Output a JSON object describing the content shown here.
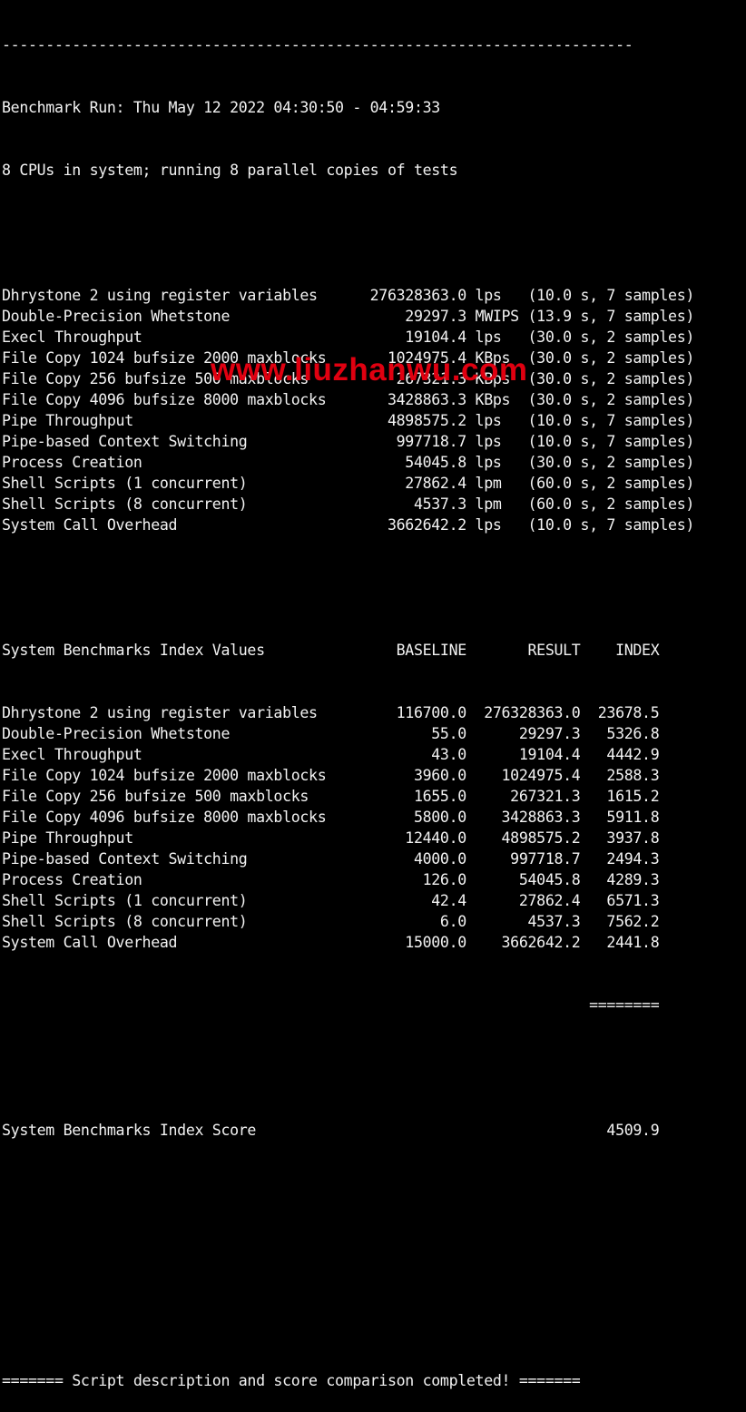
{
  "separator_top": "------------------------------------------------------------------------",
  "header": {
    "run_line": "Benchmark Run: Thu May 12 2022 04:30:50 - 04:59:33",
    "cpu_line": "8 CPUs in system; running 8 parallel copies of tests"
  },
  "results": [
    {
      "name": "Dhrystone 2 using register variables",
      "value": "276328363.0",
      "unit": "lps",
      "time": "10.0 s",
      "samples": "7 samples"
    },
    {
      "name": "Double-Precision Whetstone",
      "value": "29297.3",
      "unit": "MWIPS",
      "time": "13.9 s",
      "samples": "7 samples"
    },
    {
      "name": "Execl Throughput",
      "value": "19104.4",
      "unit": "lps",
      "time": "30.0 s",
      "samples": "2 samples"
    },
    {
      "name": "File Copy 1024 bufsize 2000 maxblocks",
      "value": "1024975.4",
      "unit": "KBps",
      "time": "30.0 s",
      "samples": "2 samples"
    },
    {
      "name": "File Copy 256 bufsize 500 maxblocks",
      "value": "267321.3",
      "unit": "KBps",
      "time": "30.0 s",
      "samples": "2 samples"
    },
    {
      "name": "File Copy 4096 bufsize 8000 maxblocks",
      "value": "3428863.3",
      "unit": "KBps",
      "time": "30.0 s",
      "samples": "2 samples"
    },
    {
      "name": "Pipe Throughput",
      "value": "4898575.2",
      "unit": "lps",
      "time": "10.0 s",
      "samples": "7 samples"
    },
    {
      "name": "Pipe-based Context Switching",
      "value": "997718.7",
      "unit": "lps",
      "time": "10.0 s",
      "samples": "7 samples"
    },
    {
      "name": "Process Creation",
      "value": "54045.8",
      "unit": "lps",
      "time": "30.0 s",
      "samples": "2 samples"
    },
    {
      "name": "Shell Scripts (1 concurrent)",
      "value": "27862.4",
      "unit": "lpm",
      "time": "60.0 s",
      "samples": "2 samples"
    },
    {
      "name": "Shell Scripts (8 concurrent)",
      "value": "4537.3",
      "unit": "lpm",
      "time": "60.0 s",
      "samples": "2 samples"
    },
    {
      "name": "System Call Overhead",
      "value": "3662642.2",
      "unit": "lps",
      "time": "10.0 s",
      "samples": "7 samples"
    }
  ],
  "index_table": {
    "title": "System Benchmarks Index Values",
    "columns": [
      "BASELINE",
      "RESULT",
      "INDEX"
    ],
    "rows": [
      {
        "name": "Dhrystone 2 using register variables",
        "baseline": "116700.0",
        "result": "276328363.0",
        "index": "23678.5"
      },
      {
        "name": "Double-Precision Whetstone",
        "baseline": "55.0",
        "result": "29297.3",
        "index": "5326.8"
      },
      {
        "name": "Execl Throughput",
        "baseline": "43.0",
        "result": "19104.4",
        "index": "4442.9"
      },
      {
        "name": "File Copy 1024 bufsize 2000 maxblocks",
        "baseline": "3960.0",
        "result": "1024975.4",
        "index": "2588.3"
      },
      {
        "name": "File Copy 256 bufsize 500 maxblocks",
        "baseline": "1655.0",
        "result": "267321.3",
        "index": "1615.2"
      },
      {
        "name": "File Copy 4096 bufsize 8000 maxblocks",
        "baseline": "5800.0",
        "result": "3428863.3",
        "index": "5911.8"
      },
      {
        "name": "Pipe Throughput",
        "baseline": "12440.0",
        "result": "4898575.2",
        "index": "3937.8"
      },
      {
        "name": "Pipe-based Context Switching",
        "baseline": "4000.0",
        "result": "997718.7",
        "index": "2494.3"
      },
      {
        "name": "Process Creation",
        "baseline": "126.0",
        "result": "54045.8",
        "index": "4289.3"
      },
      {
        "name": "Shell Scripts (1 concurrent)",
        "baseline": "42.4",
        "result": "27862.4",
        "index": "6571.3"
      },
      {
        "name": "Shell Scripts (8 concurrent)",
        "baseline": "6.0",
        "result": "4537.3",
        "index": "7562.2"
      },
      {
        "name": "System Call Overhead",
        "baseline": "15000.0",
        "result": "3662642.2",
        "index": "2441.8"
      }
    ],
    "score_separator": "========",
    "score_label": "System Benchmarks Index Score",
    "score_value": "4509.9"
  },
  "footer": "======= Script description and score comparison completed! =======",
  "watermark": {
    "text": "www.liuzhanwu.com",
    "color": "#e00010"
  }
}
